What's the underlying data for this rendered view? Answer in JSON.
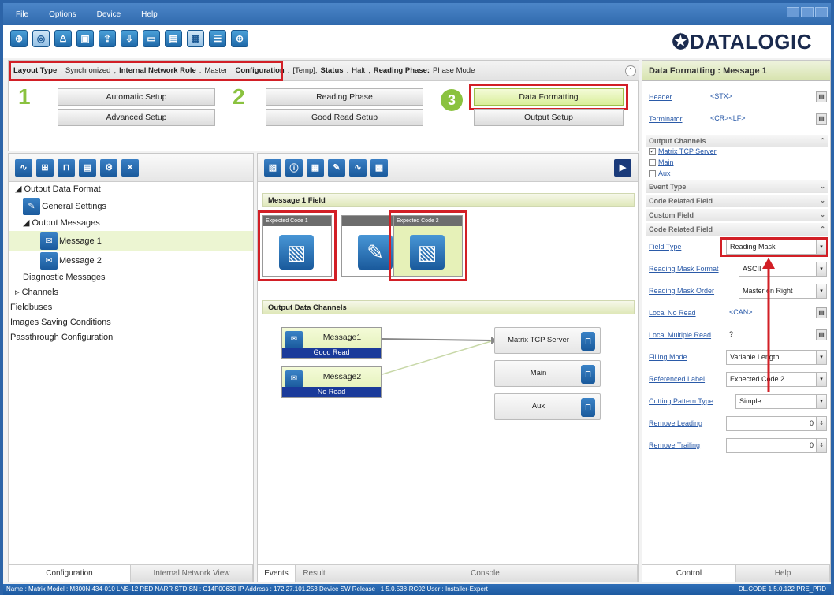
{
  "menu": [
    "File",
    "Options",
    "Device",
    "Help"
  ],
  "brand": "DATALOGIC",
  "status_line": {
    "layout_type_label": "Layout Type",
    "layout_type_value": "Synchronized",
    "role_label": "Internal Network Role",
    "role_value": "Master",
    "config_label": "Configuration",
    "config_value": "[Temp];",
    "status_label": "Status",
    "status_value": "Halt",
    "phase_label": "Reading Phase:",
    "phase_value": "Phase Mode"
  },
  "steps": {
    "s1": "1",
    "s2": "2",
    "s3": "3",
    "automatic_setup": "Automatic Setup",
    "advanced_setup": "Advanced Setup",
    "reading_phase": "Reading Phase",
    "good_read_setup": "Good Read Setup",
    "data_formatting": "Data Formatting",
    "output_setup": "Output Setup"
  },
  "tree": {
    "output_data_format": "Output Data Format",
    "general_settings": "General Settings",
    "output_messages": "Output Messages",
    "message1": "Message 1",
    "message2": "Message 2",
    "diagnostic_messages": "Diagnostic Messages",
    "channels": "Channels",
    "fieldbuses": "Fieldbuses",
    "images_saving": "Images Saving Conditions",
    "passthrough": "Passthrough Configuration"
  },
  "left_tabs": [
    "Configuration",
    "Internal Network View"
  ],
  "mid": {
    "message_field_title": "Message 1 Field",
    "card1": "Expected Code 1",
    "card3": "Expected Code 2",
    "output_channels_title": "Output Data Channels",
    "msg1": "Message1",
    "msg1_status": "Good Read",
    "msg2": "Message2",
    "msg2_status": "No Read",
    "ch1": "Matrix TCP Server",
    "ch2": "Main",
    "ch3": "Aux",
    "tabs": [
      "Events",
      "Result",
      "Console"
    ]
  },
  "right": {
    "title": "Data Formatting : Message 1",
    "header_label": "Header",
    "header_value": "<STX>",
    "terminator_label": "Terminator",
    "terminator_value": "<CR><LF>",
    "output_channels": "Output Channels",
    "ch_matrix": "Matrix TCP Server",
    "ch_main": "Main",
    "ch_aux": "Aux",
    "event_type": "Event Type",
    "code_related1": "Code Related Field",
    "custom_field": "Custom Field",
    "code_related2": "Code Related Field",
    "field_type_label": "Field Type",
    "field_type_value": "Reading Mask",
    "rm_format_label": "Reading Mask Format",
    "rm_format_value": "ASCII",
    "rm_order_label": "Reading Mask Order",
    "rm_order_value": "Master on Right",
    "local_noread_label": "Local No Read",
    "local_noread_value": "<CAN>",
    "local_multi_label": "Local Multiple Read",
    "local_multi_value": "?",
    "filling_label": "Filling Mode",
    "filling_value": "Variable Length",
    "ref_label": "Referenced Label",
    "ref_value": "Expected Code 2",
    "cutting_label": "Cutting Pattern Type",
    "cutting_value": "Simple",
    "remove_leading_label": "Remove Leading",
    "remove_leading_value": "0",
    "remove_trailing_label": "Remove Trailing",
    "remove_trailing_value": "0",
    "tabs": [
      "Control",
      "Help"
    ]
  },
  "statusbar": {
    "left": "Name : Matrix  Model : M300N 434-010 LNS-12 RED NARR STD   SN : C14P00630   IP Address : 172.27.101.253   Device SW Release : 1.5.0.538-RC02   User : Installer-Expert",
    "right": "DL.CODE 1.5.0.122 PRE_PRD"
  },
  "colors": {
    "accent_green": "#8ac23f",
    "highlight_red": "#d21f26",
    "title_blue": "#2f69ad"
  }
}
